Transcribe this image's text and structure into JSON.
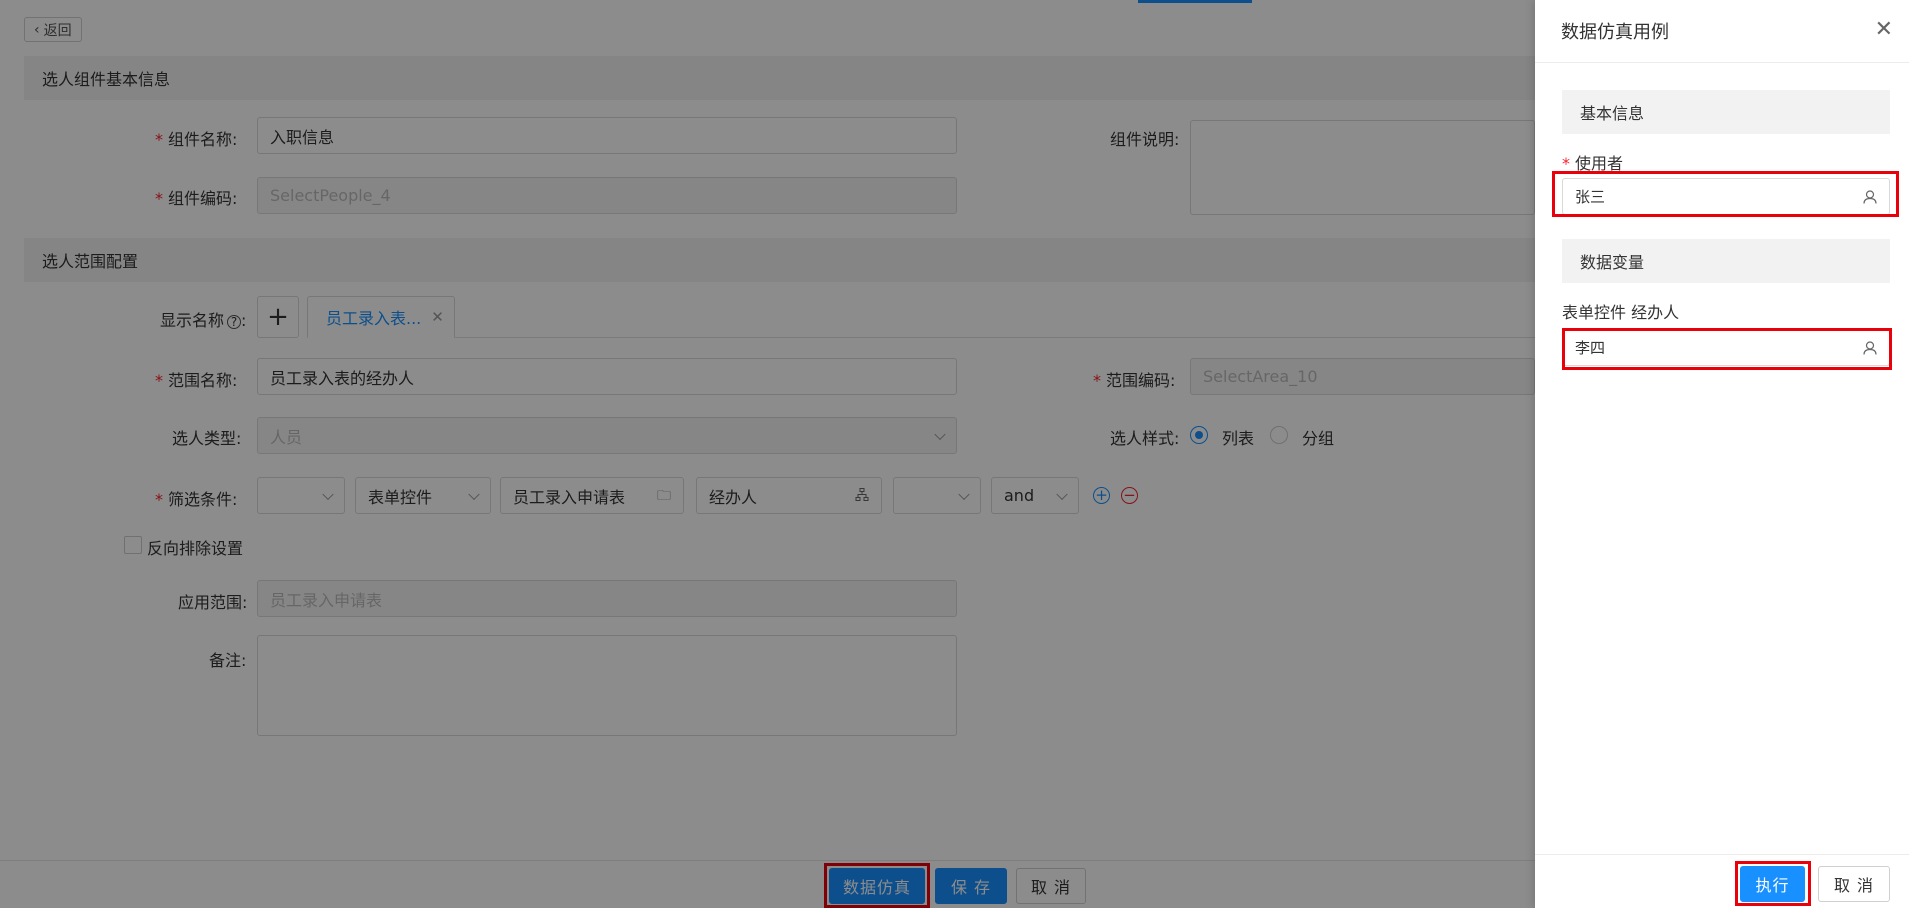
{
  "main": {
    "back_label": "返回",
    "sections": {
      "basic_info": "选人组件基本信息",
      "scope_config": "选人范围配置"
    },
    "component_name": {
      "label": "组件名称",
      "value": "入职信息"
    },
    "component_desc": {
      "label": "组件说明"
    },
    "component_code": {
      "label": "组件编码",
      "value": "SelectPeople_4"
    },
    "display_name": {
      "label": "显示名称",
      "tab_label": "员工录入表..."
    },
    "scope_name": {
      "label": "范围名称",
      "value": "员工录入表的经办人"
    },
    "scope_code": {
      "label": "范围编码",
      "value": "SelectArea_10"
    },
    "person_type": {
      "label": "选人类型",
      "value": "人员"
    },
    "person_style": {
      "label": "选人样式",
      "options": [
        "列表",
        "分组"
      ],
      "selected": "列表"
    },
    "filter": {
      "label": "筛选条件",
      "field1": "",
      "field2": "表单控件",
      "field3": "员工录入申请表",
      "field4": "经办人",
      "field5": "",
      "field6": "and"
    },
    "reverse_exclude": {
      "label": "反向排除设置",
      "checked": false
    },
    "apply_scope": {
      "label": "应用范围",
      "placeholder": "员工录入申请表"
    },
    "remark": {
      "label": "备注"
    },
    "footer": {
      "simulate_label": "数据仿真",
      "save_label": "保 存",
      "cancel_label": "取 消"
    }
  },
  "drawer": {
    "title": "数据仿真用例",
    "basic_section": "基本信息",
    "user_label": "使用者",
    "user_value": "张三",
    "variable_section": "数据变量",
    "variable_label": "表单控件 经办人",
    "variable_value": "李四",
    "execute_label": "执行",
    "cancel_label": "取 消"
  },
  "colors": {
    "primary": "#1890ff",
    "required": "#f5222d",
    "highlight": "#e8000b"
  }
}
